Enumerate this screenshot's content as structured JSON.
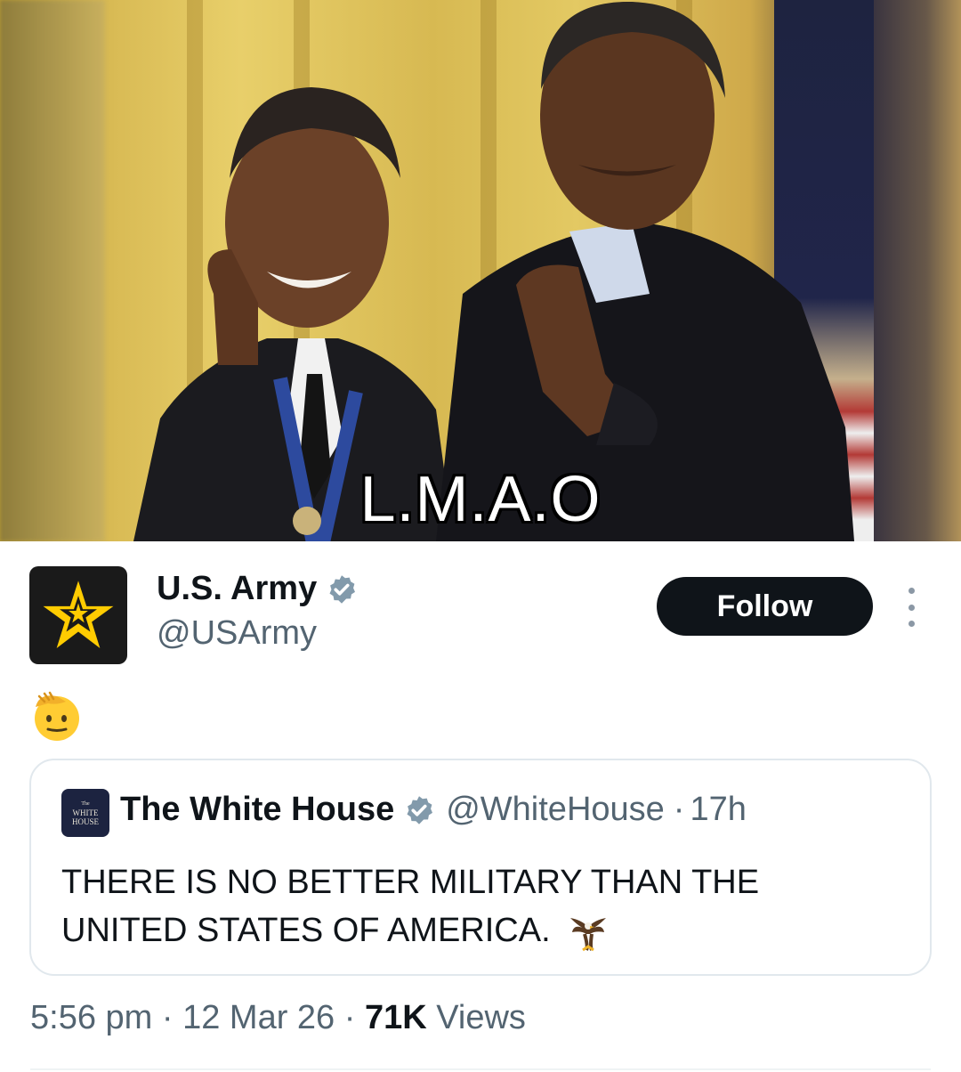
{
  "meme": {
    "caption": "L.M.A.O"
  },
  "author": {
    "name": "U.S. Army",
    "handle": "@USArmy",
    "verified_icon": "verified-badge-icon",
    "avatar_icon": "army-star-icon"
  },
  "actions": {
    "follow_label": "Follow",
    "more_icon": "more-options-icon"
  },
  "post": {
    "body_emoji": "saluting-face-emoji"
  },
  "quoted": {
    "name": "The White House",
    "handle": "@WhiteHouse",
    "separator": "·",
    "age": "17h",
    "avatar_lines": [
      "The",
      "WHITE",
      "HOUSE"
    ],
    "text": "THERE IS NO BETTER MILITARY THAN THE UNITED STATES OF AMERICA.",
    "emoji": "eagle-emoji"
  },
  "meta": {
    "time": "5:56 pm",
    "sep1": " · ",
    "date": "12 Mar 26",
    "sep2": " · ",
    "views_count": "71K",
    "views_label": " Views"
  },
  "colors": {
    "text": "#0f1419",
    "secondary": "#536471",
    "verified": "#829aab",
    "follow_bg": "#0f1419",
    "army_gold": "#ffcc01"
  }
}
